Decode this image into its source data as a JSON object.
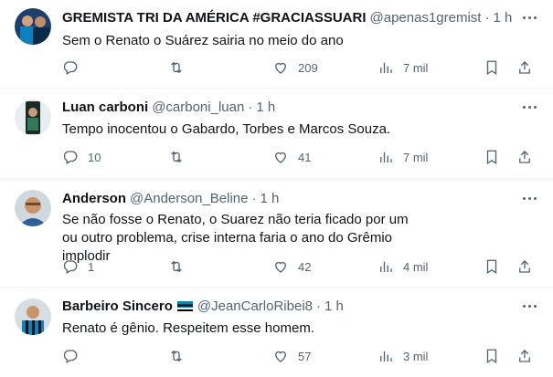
{
  "tweets": [
    {
      "name": "GREMISTA TRI DA AMÉRICA #GRACIASSUARI",
      "handle": "@apenas1gremist",
      "time": "1 h",
      "text": "Sem o Renato o Suárez sairia no meio do ano",
      "replies": "",
      "retweets": "",
      "likes": "209",
      "views": "7 mil",
      "flag": false
    },
    {
      "name": "Luan carboni",
      "handle": "@carboni_luan",
      "time": "1 h",
      "text": "Tempo inocentou o Gabardo, Torbes e Marcos Souza.",
      "replies": "10",
      "retweets": "",
      "likes": "41",
      "views": "7 mil",
      "flag": false
    },
    {
      "name": "Anderson",
      "handle": "@Anderson_Beline",
      "time": "1 h",
      "text": "Se não fosse o Renato, o Suarez não teria ficado por um ou outro problema, crise interna faria o ano do Grêmio implodir",
      "replies": "1",
      "retweets": "",
      "likes": "42",
      "views": "4 mil",
      "flag": false
    },
    {
      "name": "Barbeiro Sincero",
      "handle": "@JeanCarloRibei8",
      "time": "1 h",
      "text": "Renato é gênio. Respeitem esse homem.",
      "replies": "",
      "retweets": "",
      "likes": "57",
      "views": "3 mil",
      "flag": true
    }
  ],
  "icons": {
    "reply": "reply-icon",
    "retweet": "retweet-icon",
    "like": "heart-icon",
    "views": "views-icon",
    "bookmark": "bookmark-icon",
    "share": "share-icon",
    "more": "more-icon",
    "flag": "gremio-flag-icon"
  },
  "colors": {
    "text": "#0f1419",
    "secondary": "#536471",
    "border": "#eff3f4",
    "flag_blue": "#0d80bf",
    "flag_black": "#000000"
  }
}
